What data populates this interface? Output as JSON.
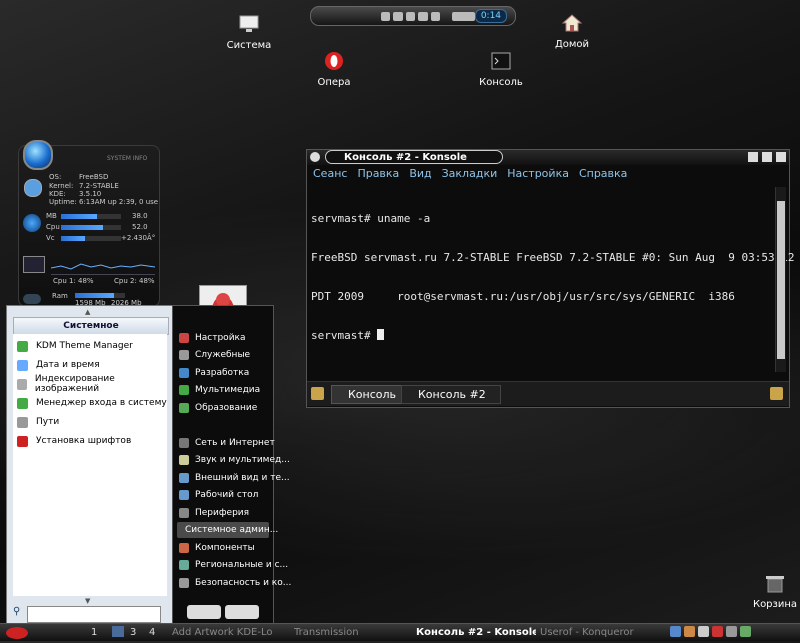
{
  "desktop": {
    "icons": [
      {
        "label": "Система",
        "icon": "computer-icon"
      },
      {
        "label": "Домой",
        "icon": "home-icon"
      },
      {
        "label": "Опера",
        "icon": "opera-icon"
      },
      {
        "label": "Консоль",
        "icon": "terminal-icon"
      },
      {
        "label": "Корзина",
        "icon": "trash-icon"
      }
    ]
  },
  "player": {
    "time": "0:14"
  },
  "sysinfo": {
    "title": "SYSTEM INFO",
    "os_label": "OS:",
    "os": "FreeBSD",
    "kernel_label": "Kernel:",
    "kernel": "7.2-STABLE",
    "kde_label": "KDE:",
    "kde": "3.5.10",
    "uptime_label": "Uptime:",
    "uptime": "6:13AM  up  2:39, 0 use",
    "mb_label": "MB",
    "mb": "38.0",
    "cpu_label": "Cpu",
    "cpu": "52.0",
    "vc_label": "Vc",
    "vc": "+2.430Â°",
    "cpu1": "Cpu 1: 48%",
    "cpu2": "Cpu 2: 48%",
    "ram_label": "Ram",
    "ram_used": "1598 Mb",
    "ram_total": "2026 Mb"
  },
  "konsole": {
    "title": "Консоль #2 - Konsole",
    "menu": [
      "Сеанс",
      "Правка",
      "Вид",
      "Закладки",
      "Настройка",
      "Справка"
    ],
    "terminal": [
      "servmast# uname -a",
      "FreeBSD servmast.ru 7.2-STABLE FreeBSD 7.2-STABLE #0: Sun Aug  9 03:53:12",
      "PDT 2009     root@servmast.ru:/usr/obj/usr/src/sys/GENERIC  i386",
      "servmast# "
    ],
    "tabs": [
      "Консоль",
      "Консоль #2"
    ]
  },
  "kmenu": {
    "header": "Системное администрирование",
    "items": [
      "KDM Theme Manager",
      "Дата и время",
      "Индексирование изображений",
      "Менеджер входа в систему",
      "Пути",
      "Установка шрифтов"
    ],
    "categories": [
      "Настройка",
      "Служебные",
      "Разработка",
      "Мультимедиа",
      "Образование",
      "Сеть и Интернет",
      "Звук и мультимед...",
      "Внешний вид и те...",
      "Рабочий стол",
      "Периферия",
      "Системное админ...",
      "Компоненты",
      "Региональные и с...",
      "Безопасность и ко..."
    ]
  },
  "taskbar": {
    "desktops": [
      "1",
      "2",
      "3",
      "4"
    ],
    "tasks": [
      "Add Artwork KDE-Lo",
      "Transmission",
      "Консоль #2 - Konsole",
      "Userof - Konqueror"
    ]
  }
}
